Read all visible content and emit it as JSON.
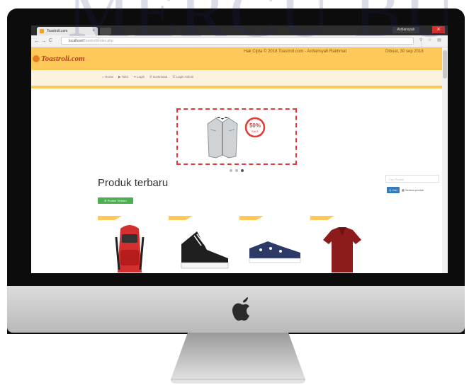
{
  "watermark": "MERCU BU",
  "browser": {
    "tab_title": "Toastroli.com",
    "tab_close": "×",
    "user_chip": "Ardiansyah",
    "win_close": "✕",
    "url_host": "localhost/",
    "url_path": "Toastroli/index.php",
    "nav_back": "←",
    "nav_forward": "→",
    "nav_reload": "C",
    "nav_secure": "ⓘ",
    "ext_icons": "⚲ ☆ ▤ ⋮"
  },
  "site": {
    "logo_text": "Toastroli.com",
    "header_info": "Hak Cipta © 2018 Toastroli.com - Ardiansyah Rakhmat",
    "header_date": "Dibuat, 30 sep 2018",
    "menu": [
      {
        "label": "⌂ Home"
      },
      {
        "label": "▶ Toko"
      },
      {
        "label": "➜ Login"
      },
      {
        "label": "✆ Download"
      },
      {
        "label": "☰ Login Admin"
      }
    ],
    "banner": {
      "sale_text": "50%",
      "sale_sub": "SALE"
    },
    "product_heading": "Produk terbaru",
    "new_product_button": "⊕ Produk Terbaru",
    "search_placeholder": "Cari Produk",
    "search_button": "Q Cari",
    "all_products_button": "▦ Semua produk"
  },
  "products": [
    {
      "name": "backpack",
      "color": "#d32f2f"
    },
    {
      "name": "sneaker",
      "color": "#1f1f1f"
    },
    {
      "name": "shoe",
      "color": "#2b3a67"
    },
    {
      "name": "polo",
      "color": "#8e1b1b"
    }
  ],
  "colors": {
    "header": "#ffc85a",
    "accent_red": "#e53935",
    "accent_green": "#4caf50",
    "accent_blue": "#337ab7"
  }
}
